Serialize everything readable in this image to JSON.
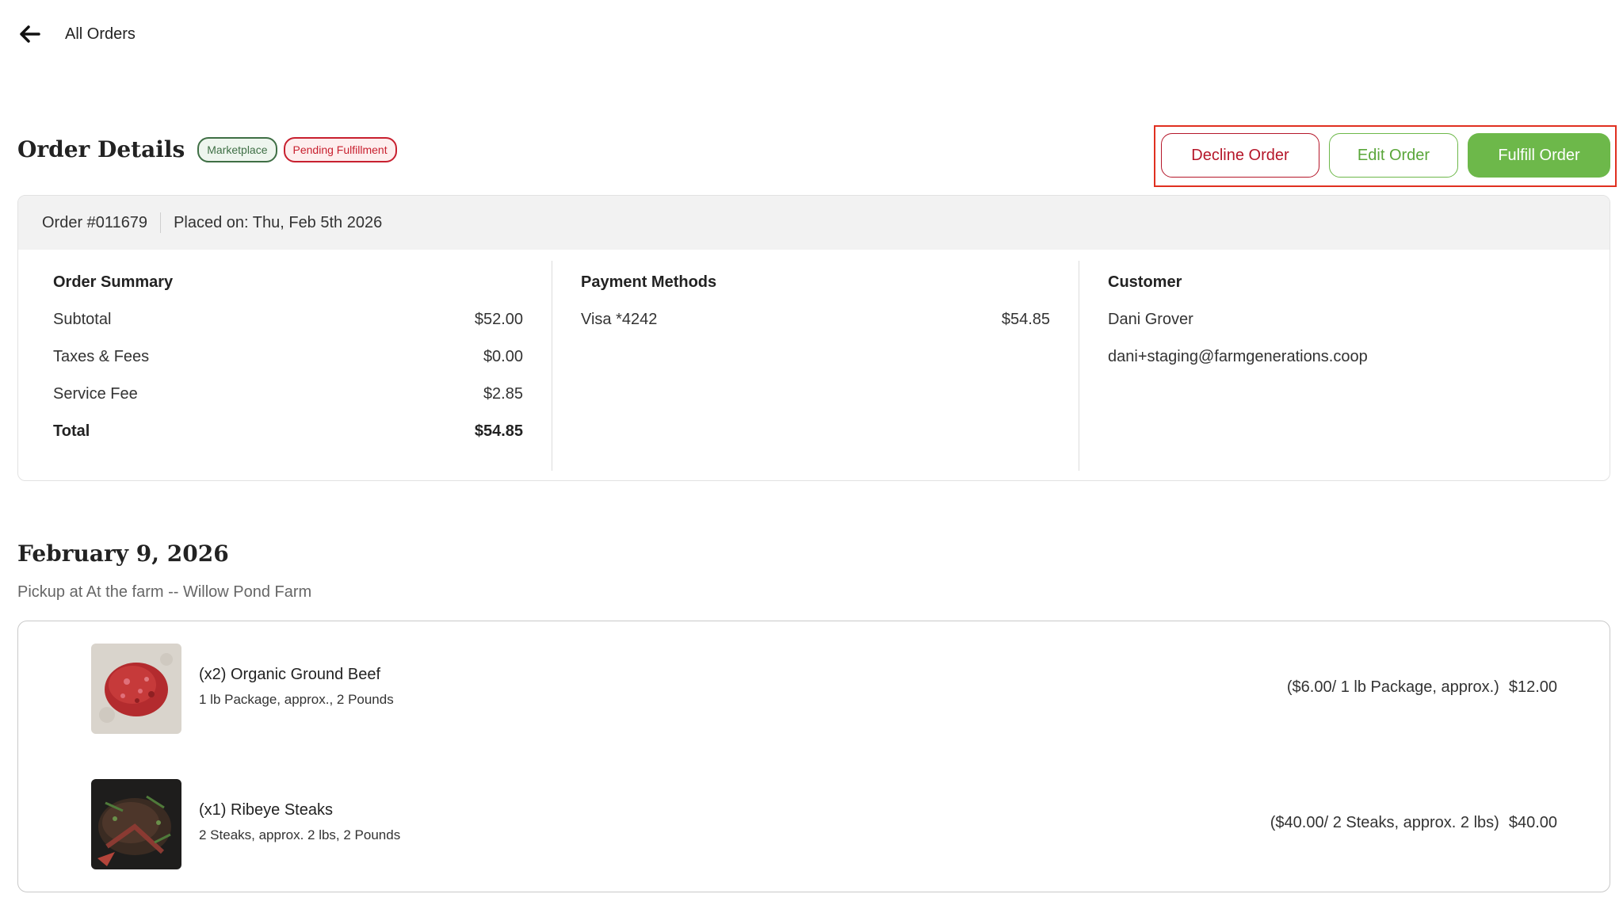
{
  "nav": {
    "back_label": "All Orders",
    "back_icon": "arrow-left-icon"
  },
  "header": {
    "title": "Order Details",
    "badges": [
      {
        "label": "Marketplace",
        "color": "#3f6f45"
      },
      {
        "label": "Pending Fulfillment",
        "color": "#c8202f"
      }
    ]
  },
  "actions": {
    "decline_label": "Decline Order",
    "edit_label": "Edit Order",
    "fulfill_label": "Fulfill Order",
    "accent_green": "#6db84a",
    "accent_red": "#b5172a"
  },
  "order": {
    "number": "Order #011679",
    "placed_on": "Placed on: Thu, Feb 5th 2026"
  },
  "summary": {
    "title": "Order Summary",
    "lines": [
      {
        "label": "Subtotal",
        "value": "$52.00"
      },
      {
        "label": "Taxes & Fees",
        "value": "$0.00"
      },
      {
        "label": "Service Fee",
        "value": "$2.85"
      },
      {
        "label": "Total",
        "value": "$54.85"
      }
    ]
  },
  "payment": {
    "title": "Payment Methods",
    "lines": [
      {
        "label": "Visa *4242",
        "value": "$54.85"
      }
    ]
  },
  "customer": {
    "title": "Customer",
    "name": "Dani Grover",
    "email": "dani+staging@farmgenerations.coop"
  },
  "delivery": {
    "date": "February 9, 2026",
    "pickup": "Pickup at At the farm -- Willow Pond Farm"
  },
  "items": [
    {
      "name": "(x2) Organic Ground Beef",
      "details": "1 lb Package, approx., 2 Pounds",
      "unit_price": "($6.00/ 1 lb Package, approx.)",
      "total": "$12.00",
      "image": "ground-beef-photo"
    },
    {
      "name": "(x1) Ribeye Steaks",
      "details": "2 Steaks, approx. 2 lbs, 2 Pounds",
      "unit_price": "($40.00/ 2 Steaks, approx. 2 lbs)",
      "total": "$40.00",
      "image": "ribeye-steak-photo"
    }
  ]
}
